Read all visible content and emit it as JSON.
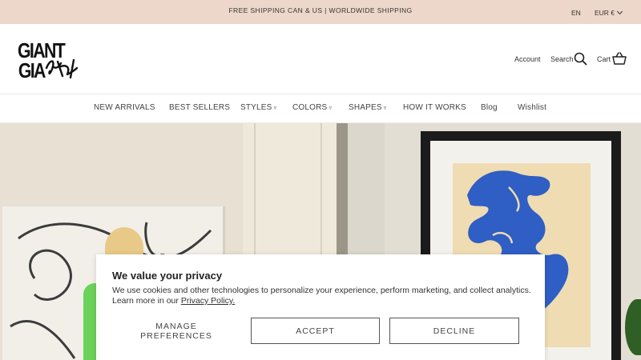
{
  "announcement": {
    "message": "FREE SHIPPING CAN & US | WORLDWIDE SHIPPING",
    "language": "EN",
    "currency": "EUR €"
  },
  "header": {
    "logo_text": "GIANT Art",
    "account_label": "Account",
    "search_label": "Search",
    "cart_label": "Cart"
  },
  "nav": {
    "items": [
      {
        "label": "NEW ARRIVALS"
      },
      {
        "label": "BEST SELLERS"
      },
      {
        "label": "STYLES",
        "dropdown": "▿"
      },
      {
        "label": "COLORS",
        "dropdown": "▿"
      },
      {
        "label": "SHAPES",
        "dropdown": "▿"
      },
      {
        "label": "HOW IT WORKS"
      },
      {
        "label": "Blog"
      },
      {
        "label": "Wishlist"
      }
    ]
  },
  "cookie_banner": {
    "title": "We value your privacy",
    "body_text": "We use cookies and other technologies to personalize your experience, perform marketing, and collect analytics. Learn more in our",
    "policy_link": "Privacy Policy.",
    "manage_label": "MANAGE PREFERENCES",
    "accept_label": "ACCEPT",
    "decline_label": "DECLINE"
  },
  "colors": {
    "announcement_bg": "#ecd7ca",
    "matisse_blue": "#2f5ec4",
    "accent_green": "#6bd35a"
  },
  "icons": {
    "search": "search-icon",
    "cart": "cart-icon",
    "currency_dropdown": "chevron-down-icon"
  }
}
